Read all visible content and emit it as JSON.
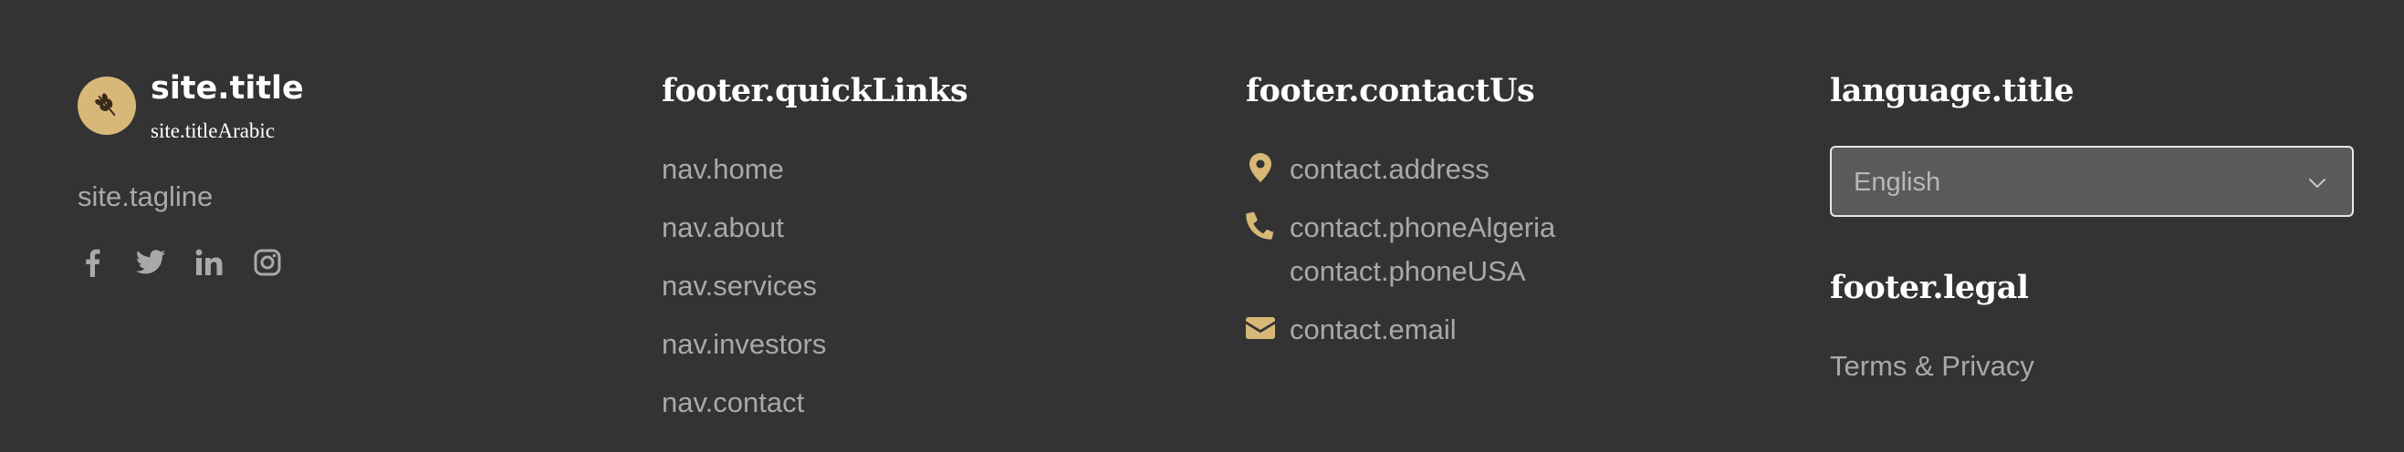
{
  "brand": {
    "title": "site.title",
    "title_arabic": "site.titleArabic",
    "tagline": "site.tagline",
    "logo_icon": "wheat-leaf-icon",
    "accent_color": "#d8b878"
  },
  "social": [
    {
      "icon": "facebook-icon"
    },
    {
      "icon": "twitter-icon"
    },
    {
      "icon": "linkedin-icon"
    },
    {
      "icon": "instagram-icon"
    }
  ],
  "quick_links": {
    "heading": "footer.quickLinks",
    "items": [
      {
        "label": "nav.home"
      },
      {
        "label": "nav.about"
      },
      {
        "label": "nav.services"
      },
      {
        "label": "nav.investors"
      },
      {
        "label": "nav.contact"
      }
    ]
  },
  "contact": {
    "heading": "footer.contactUs",
    "address": "contact.address",
    "phone_algeria": "contact.phoneAlgeria",
    "phone_usa": "contact.phoneUSA",
    "email": "contact.email",
    "icons": [
      "map-pin-icon",
      "phone-icon",
      "envelope-icon"
    ]
  },
  "language": {
    "heading": "language.title",
    "selected": "English"
  },
  "legal": {
    "heading": "footer.legal",
    "link": "Terms & Privacy"
  },
  "colors": {
    "background": "#333333",
    "text_muted": "#a9a9a9",
    "heading": "#ffffff",
    "accent": "#d8b878"
  }
}
